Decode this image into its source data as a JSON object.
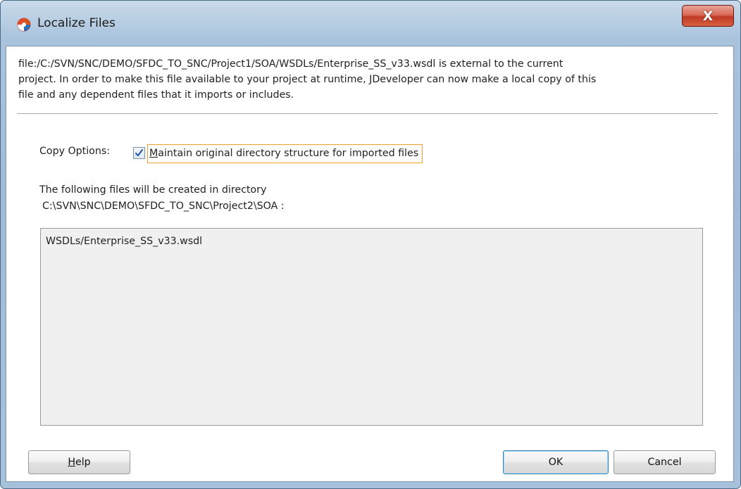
{
  "window": {
    "title": "Localize Files",
    "close_glyph": "X"
  },
  "description": {
    "lines": [
      "file:/C:/SVN/SNC/DEMO/SFDC_TO_SNC/Project1/SOA/WSDLs/Enterprise_SS_v33.wsdl is external to the current",
      "project. In order to make this file available to your project at runtime, JDeveloper can now make a local copy of this",
      "file and any dependent files that it imports or includes."
    ]
  },
  "copy_options": {
    "label": "Copy Options:",
    "checkbox_checked": true,
    "checkbox_label_mnemonic": "M",
    "checkbox_label_rest": "aintain original directory structure for imported files"
  },
  "target": {
    "line1": "The following files will be created in directory",
    "line2": "C:\\SVN\\SNC\\DEMO\\SFDC_TO_SNC\\Project2\\SOA :"
  },
  "files": [
    "WSDLs/Enterprise_SS_v33.wsdl"
  ],
  "buttons": {
    "help_mnemonic": "H",
    "help_rest": "elp",
    "ok": "OK",
    "cancel": "Cancel"
  },
  "icons": {
    "app": "jdeveloper-app-icon",
    "close": "close-icon",
    "check": "checkmark-icon"
  },
  "colors": {
    "titlebar": "#a9c3dc",
    "close_button": "#c13a26",
    "focus_outline": "#f0a030",
    "checkmark": "#2a5db0"
  }
}
